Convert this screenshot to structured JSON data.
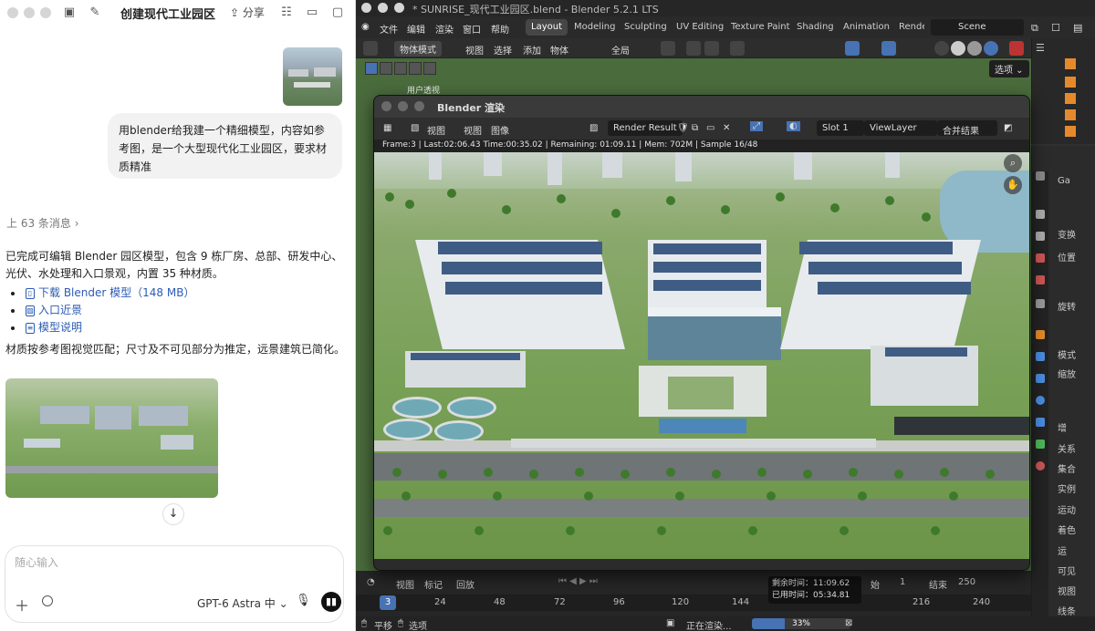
{
  "chat": {
    "title": "创建现代工业园区",
    "share_label": "分享",
    "user_message": "用blender给我建一个精细模型，内容如参考图，是一个大型现代化工业园区，要求材质精准",
    "previous_messages": "上 63 条消息",
    "reply_text": "已完成可编辑 Blender 园区模型，包含 9 栋厂房、总部、研发中心、光伏、水处理和入口景观，内置 35 种材质。",
    "links": [
      {
        "label": "下载 Blender 模型（148 MB）",
        "icon": "file-icon"
      },
      {
        "label": "入口近景",
        "icon": "image-icon"
      },
      {
        "label": "模型说明",
        "icon": "document-icon"
      }
    ],
    "note": "材质按参考图视觉匹配；尺寸及不可见部分为推定，远景建筑已简化。",
    "input_placeholder": "随心输入",
    "model_selector": "GPT-6 Astra 中"
  },
  "blender": {
    "window_title": "* SUNRISE_现代工业园区.blend - Blender 5.2.1 LTS",
    "menu": [
      "文件",
      "编辑",
      "渲染",
      "窗口",
      "帮助"
    ],
    "workspaces": [
      "Layout",
      "Modeling",
      "Sculpting",
      "UV Editing",
      "Texture Paint",
      "Shading",
      "Animation",
      "Rende"
    ],
    "active_workspace": "Layout",
    "scene": "Scene",
    "viewport_header": {
      "mode": "物体模式",
      "view": "视图",
      "select": "选择",
      "add": "添加",
      "object": "物体",
      "orientation": "全局"
    },
    "viewport_label": "用户透视",
    "select_button": "选项",
    "render_window": {
      "title": "Blender 渲染",
      "view1": "视图",
      "view2": "视图",
      "image": "图像",
      "render_result": "Render Result",
      "slot": "Slot 1",
      "view_layer": "ViewLayer",
      "combined": "合并结果",
      "stats": "Frame:3 | Last:02:06.43 Time:00:35.02 | Remaining: 01:09.11 | Mem: 702M | Sample 16/48"
    },
    "timeline": {
      "view": "视图",
      "marker": "标记",
      "playback": "回放",
      "start_label": "始",
      "start": "1",
      "end_label": "结束",
      "end": "250",
      "current_frame": "3",
      "ruler": [
        "24",
        "48",
        "72",
        "96",
        "120",
        "144",
        "216",
        "240"
      ]
    },
    "remaining_tip": {
      "remaining": "剩余时间：11:09.62",
      "elapsed": "已用时间：05:34.81"
    },
    "status": {
      "pan": "平移",
      "select": "选项",
      "rendering": "正在渲染...",
      "progress_label": "33%",
      "progress": 0.33
    },
    "properties": {
      "tabs_labels": [
        "Ga",
        "变换",
        "位置",
        "旋转",
        "模式",
        "缩放",
        "增",
        "关系",
        "集合",
        "实例",
        "运动",
        "着色",
        "运",
        "可见",
        "视图",
        "线条"
      ]
    },
    "accent_color": "#4772b3"
  }
}
